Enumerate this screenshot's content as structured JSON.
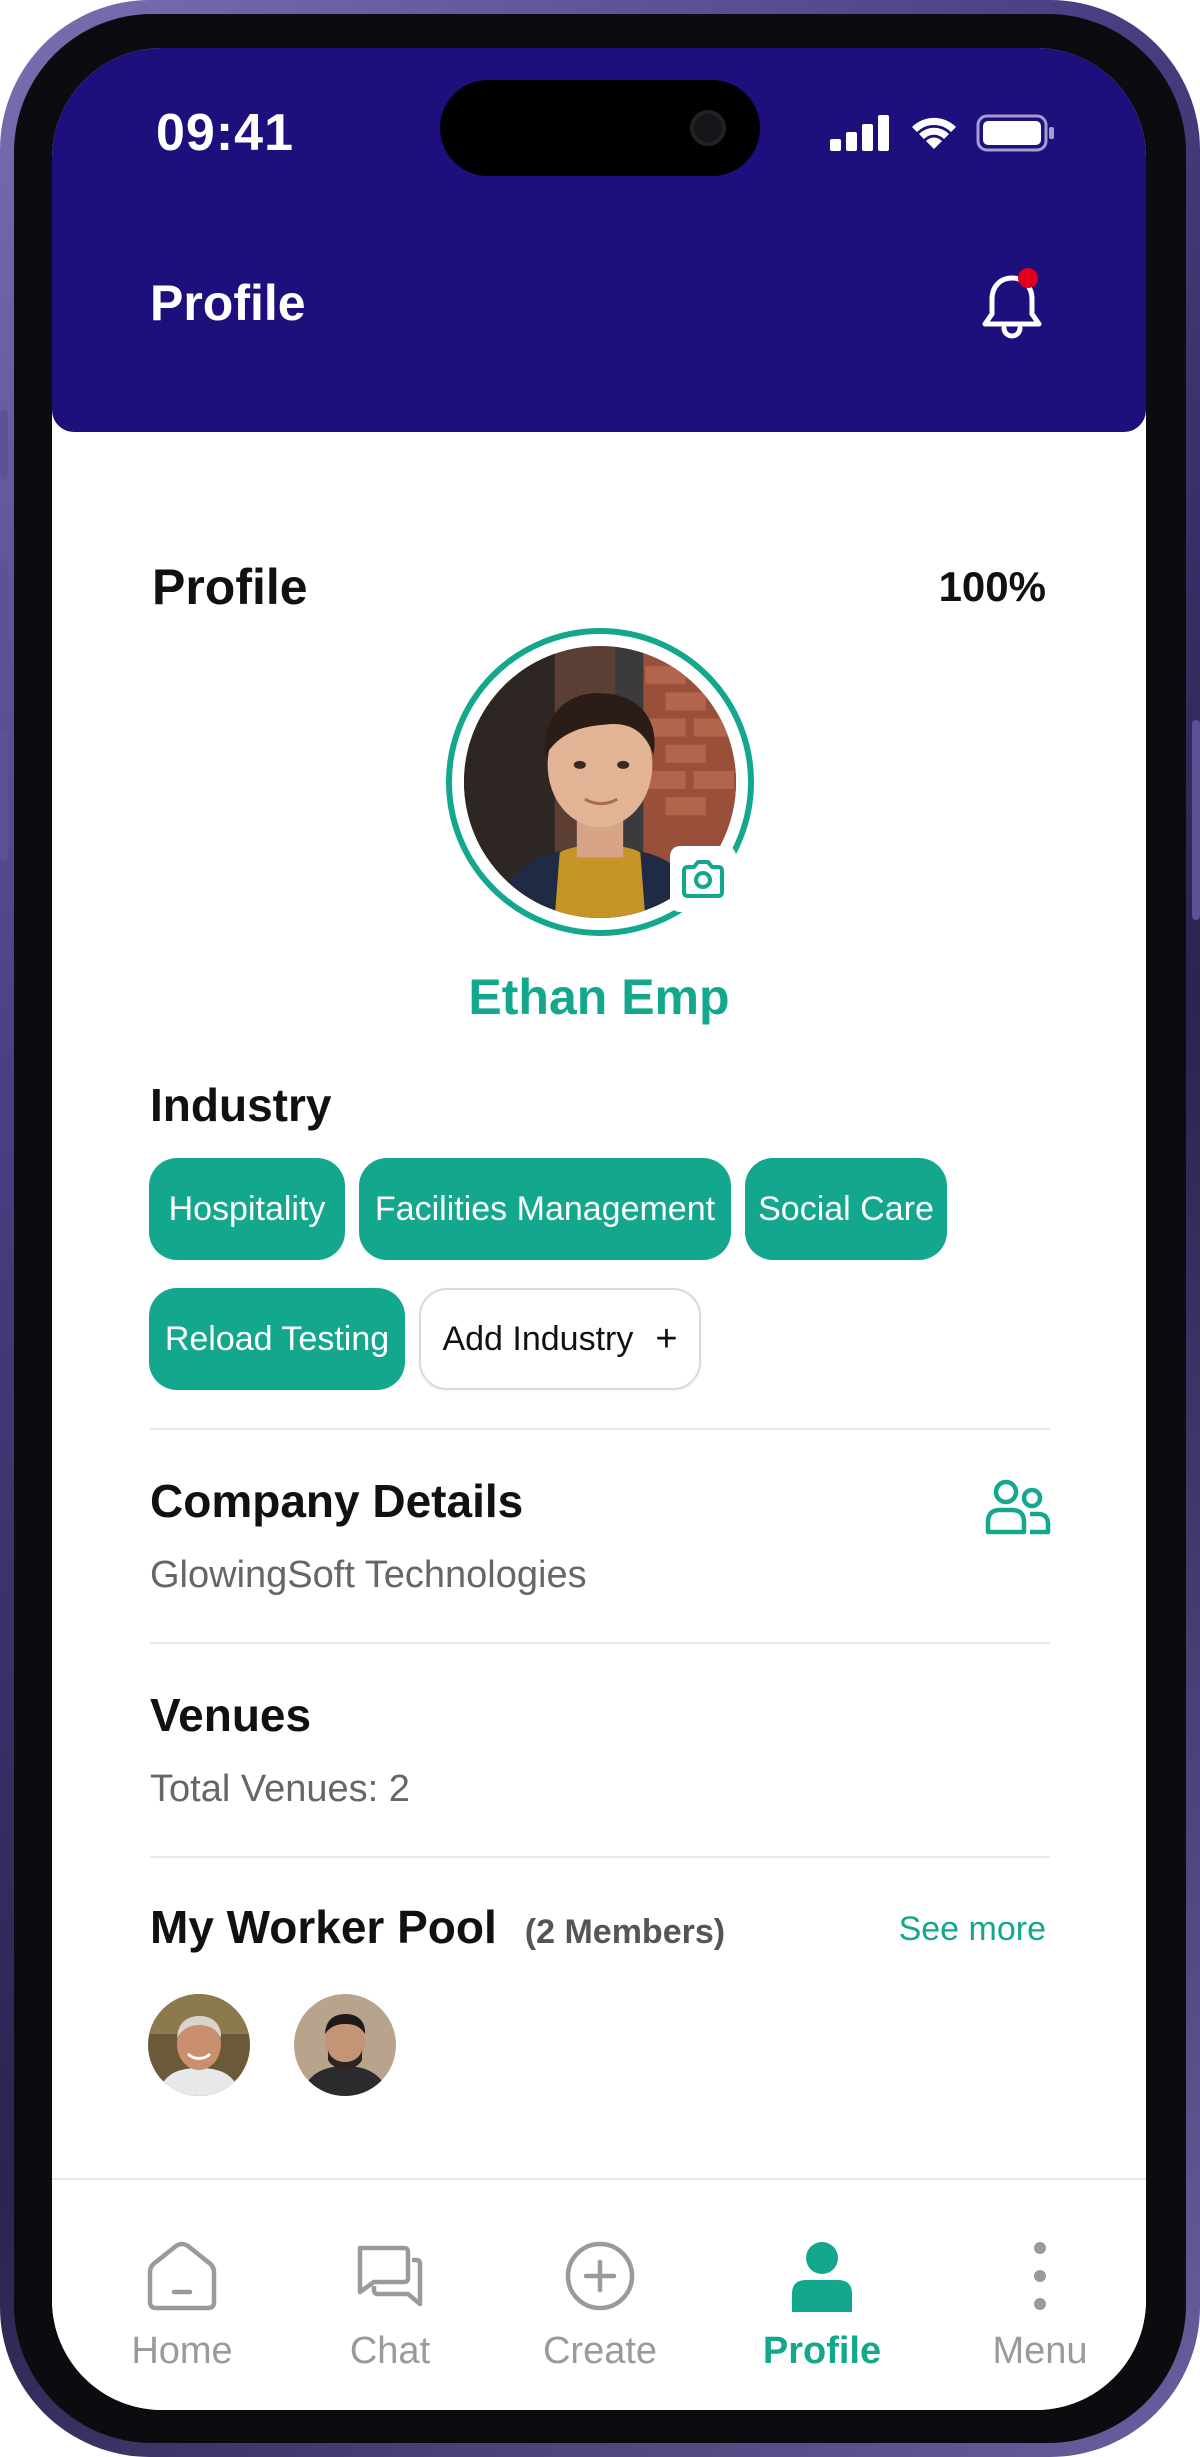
{
  "status_bar": {
    "time": "09:41"
  },
  "header": {
    "title": "Profile"
  },
  "profile": {
    "heading": "Profile",
    "completion": "100%",
    "name": "Ethan Emp"
  },
  "industry": {
    "label": "Industry",
    "chips": [
      "Hospitality",
      "Facilities Management",
      "Social Care",
      "Reload Testing"
    ],
    "add_label": "Add Industry",
    "add_symbol": "+"
  },
  "company": {
    "label": "Company Details",
    "value": "GlowingSoft Technologies"
  },
  "venues": {
    "label": "Venues",
    "total": "Total Venues: 2"
  },
  "worker_pool": {
    "label": "My Worker Pool",
    "members": "(2 Members)",
    "see_more": "See more"
  },
  "tabs": [
    {
      "label": "Home",
      "icon": "home-icon"
    },
    {
      "label": "Chat",
      "icon": "chat-icon"
    },
    {
      "label": "Create",
      "icon": "plus-circle-icon"
    },
    {
      "label": "Profile",
      "icon": "user-icon",
      "active": true
    },
    {
      "label": "Menu",
      "icon": "more-vertical-icon"
    }
  ],
  "colors": {
    "header": "#1d0f7c",
    "accent": "#13a88e",
    "notification_dot": "#e0001b"
  }
}
